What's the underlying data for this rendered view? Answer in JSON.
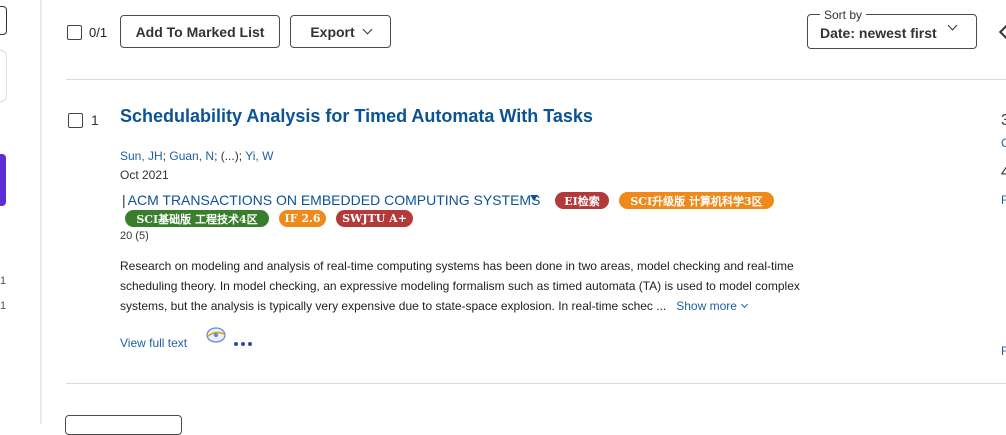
{
  "left_panel": {
    "numbers": [
      "1",
      "1"
    ]
  },
  "toolbar": {
    "selected_count": "0/1",
    "add_to_marked_list": "Add To Marked List",
    "export": "Export",
    "sort_label": "Sort by",
    "sort_value": "Date: newest first"
  },
  "record": {
    "index": "1",
    "title": "Schedulability Analysis for Timed Automata With Tasks",
    "authors": {
      "a1": "Sun, JH",
      "sep1": "; ",
      "a2": "Guan, N",
      "sep2": "; (...); ",
      "a3": "Yi, W"
    },
    "date": "Oct 2021",
    "journal_bar": "|",
    "journal": "ACM TRANSACTIONS ON EMBEDDED COMPUTING SYSTEMS",
    "badges": [
      {
        "text": "EI检索",
        "color": "#b23a3a"
      },
      {
        "text": "SCI升级版 计算机科学3区",
        "color": "#ef8a1a"
      },
      {
        "text": "SCI基础版 工程技术4区",
        "color": "#3a7d2c"
      },
      {
        "text": "IF 2.6",
        "color": "#ef8a1a"
      },
      {
        "text": "SWJTU A+",
        "color": "#b23a3a"
      }
    ],
    "citations": "20 (5)",
    "abstract_lines": [
      "Research on modeling and analysis of real-time computing systems has been done in two areas, model checking and real-time",
      "scheduling theory. In model checking, an expressive modeling formalism such as timed automata (TA) is used to model complex",
      "systems, but the analysis is typically very expensive due to state-space explosion. In real-time schec ..."
    ],
    "show_more": "Show more",
    "view_full_text": "View full text"
  },
  "right_edge": {
    "c1": "3",
    "c2": "C",
    "c3": "4",
    "c4": "F",
    "c5": "F"
  }
}
